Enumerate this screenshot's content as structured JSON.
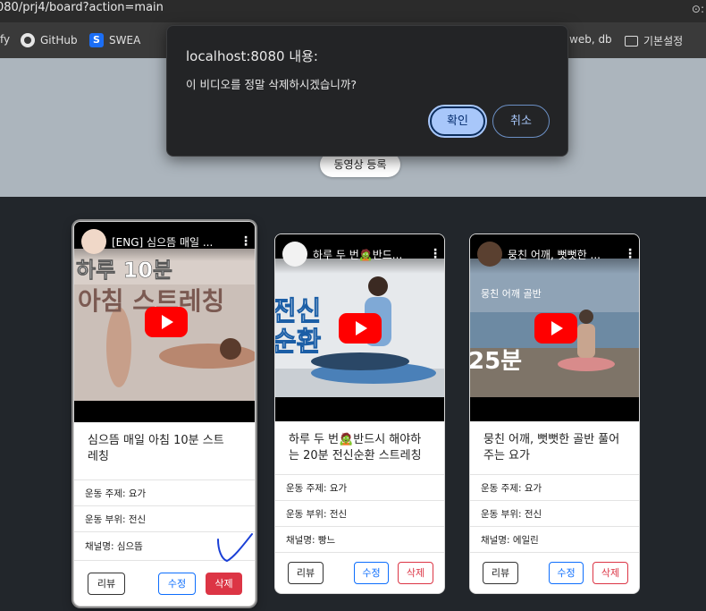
{
  "browser": {
    "url_text": "080/prj4/board?action=main",
    "bookmarks": [
      {
        "label": "fy"
      },
      {
        "label": "GitHub",
        "icon": "github-icon"
      },
      {
        "label": "SWEA",
        "icon": "swea-icon"
      },
      {
        "label": "web, db"
      },
      {
        "label": "기본설정",
        "icon": "folder-icon"
      }
    ]
  },
  "dialog": {
    "title": "localhost:8080 내용:",
    "message": "이 비디오를 정말 삭제하시겠습니까?",
    "ok_label": "확인",
    "cancel_label": "취소"
  },
  "page": {
    "register_label": "동영상 등록"
  },
  "cards": [
    {
      "video_title": "[ENG] 심으뜸 매일 ...",
      "title_line1": "심으뜸 매일 아침 10분 스트",
      "title_line2": "레칭",
      "thumb_text1": "하루 10분",
      "thumb_text2": "아침 스트레칭",
      "topic": "운동 주제: 요가",
      "part": "운동 부위: 전신",
      "channel": "채널명: 심으뜸",
      "review": "리뷰",
      "edit": "수정",
      "delete": "삭제"
    },
    {
      "video_title": "하루 두 번🧟반드...",
      "title_line1": "하루 두 번🧟반드시 해야하",
      "title_line2": "는 20분 전신순환 스트레칭",
      "thumb_text1": "전신",
      "thumb_text2": "순환",
      "topic": "운동 주제: 요가",
      "part": "운동 부위: 전신",
      "channel": "채널명: 빵느",
      "review": "리뷰",
      "edit": "수정",
      "delete": "삭제"
    },
    {
      "video_title": "뭉친 어깨, 뻣뻣한 ...",
      "title_line1": "뭉친 어깨, 뻣뻣한 골반 풀어",
      "title_line2": "주는 요가",
      "thumb_text1": "뭉친 어깨 골반",
      "thumb_text2": "25분",
      "topic": "운동 주제: 요가",
      "part": "운동 부위: 전신",
      "channel": "채널명: 에일린",
      "review": "리뷰",
      "edit": "수정",
      "delete": "삭제"
    }
  ]
}
